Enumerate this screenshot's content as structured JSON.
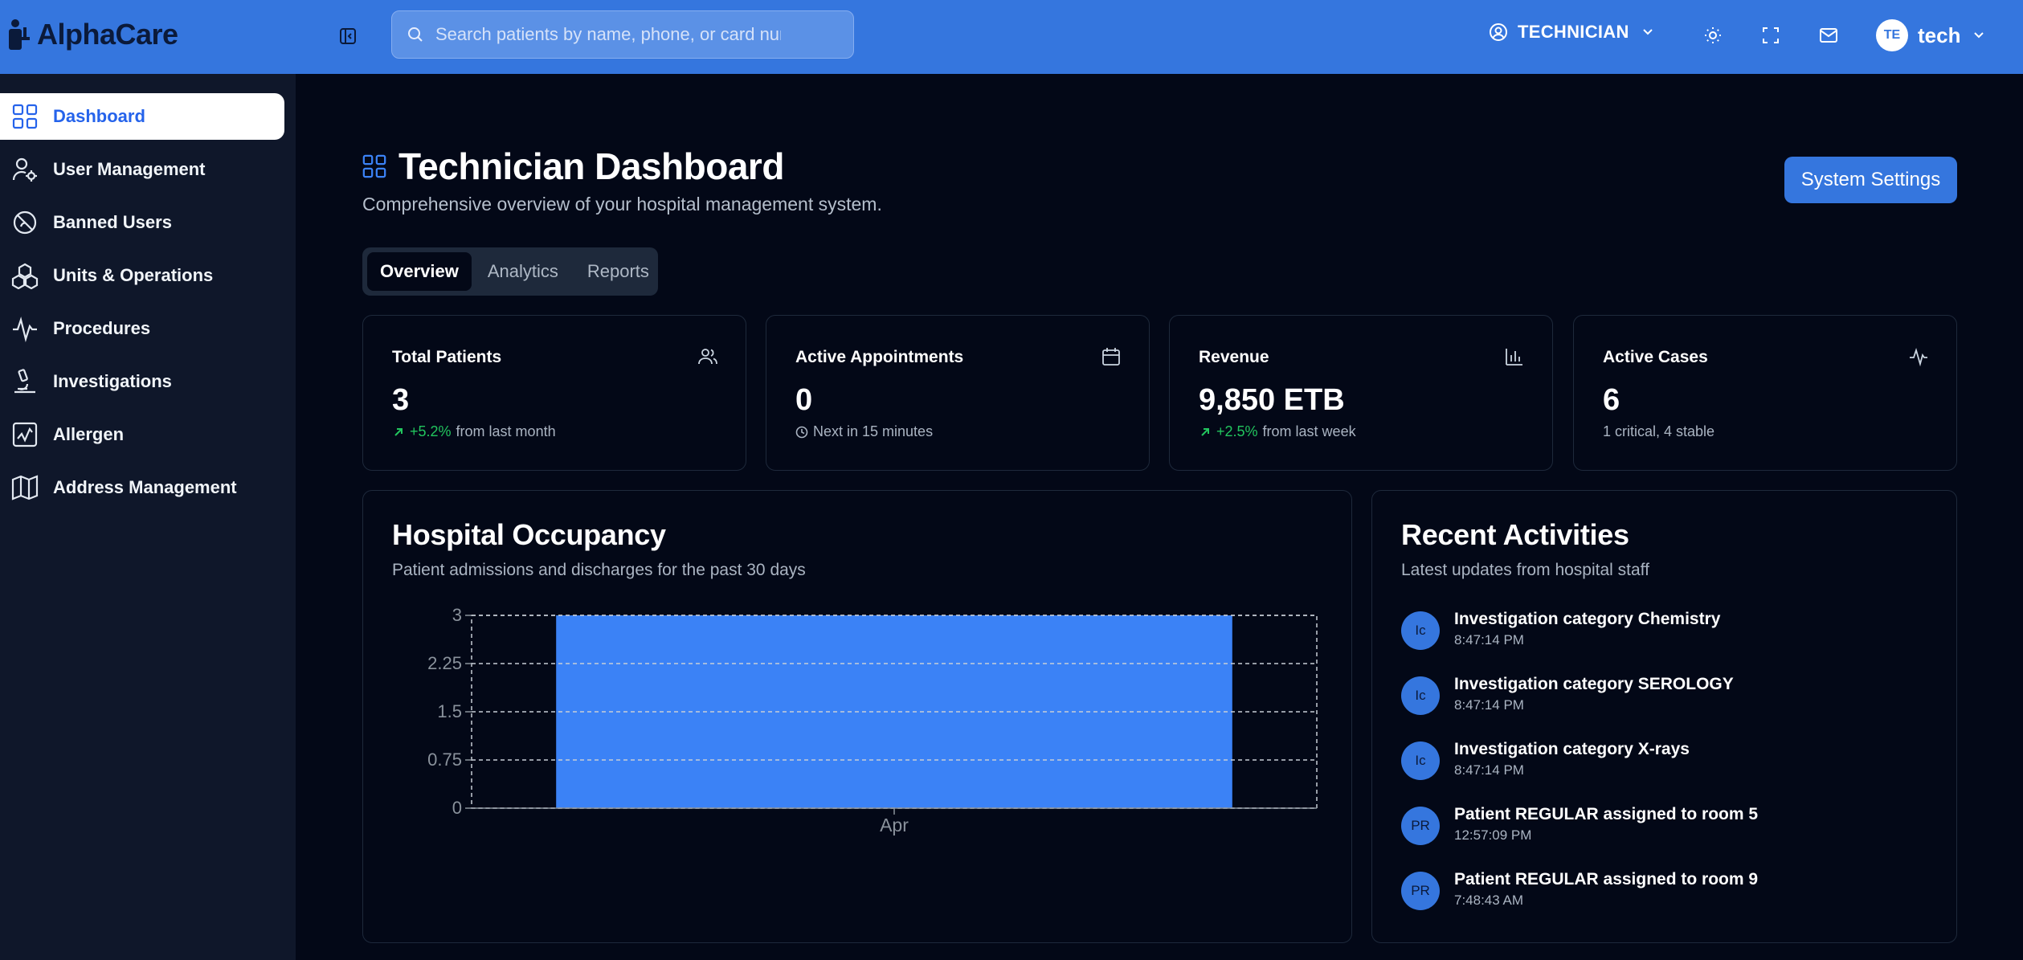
{
  "app": {
    "name": "AlphaCare"
  },
  "search": {
    "placeholder": "Search patients by name, phone, or card number"
  },
  "header": {
    "role": "TECHNICIAN",
    "user_initials": "TE",
    "user_name": "tech",
    "icons": [
      "sun-icon",
      "fullscreen-icon",
      "mail-icon"
    ]
  },
  "sidebar": {
    "items": [
      {
        "label": "Dashboard",
        "icon": "grid-icon",
        "active": true
      },
      {
        "label": "User Management",
        "icon": "user-gear-icon"
      },
      {
        "label": "Banned Users",
        "icon": "ban-icon"
      },
      {
        "label": "Units & Operations",
        "icon": "cubes-icon"
      },
      {
        "label": "Procedures",
        "icon": "activity-icon"
      },
      {
        "label": "Investigations",
        "icon": "microscope-icon"
      },
      {
        "label": "Allergen",
        "icon": "chart-box-icon"
      },
      {
        "label": "Address Management",
        "icon": "map-icon"
      }
    ]
  },
  "page": {
    "title": "Technician Dashboard",
    "subtitle": "Comprehensive overview of your hospital management system.",
    "settings_button": "System Settings",
    "tabs": [
      "Overview",
      "Analytics",
      "Reports"
    ],
    "active_tab": "Overview"
  },
  "stats": [
    {
      "title": "Total Patients",
      "value": "3",
      "trend": "+5.2%",
      "note": "from last month",
      "icon": "users-icon"
    },
    {
      "title": "Active Appointments",
      "value": "0",
      "note": "Next in 15 minutes",
      "icon": "calendar-icon"
    },
    {
      "title": "Revenue",
      "value": "9,850 ETB",
      "trend": "+2.5%",
      "note": "from last week",
      "icon": "bar-chart-icon"
    },
    {
      "title": "Active Cases",
      "value": "6",
      "note": "1 critical, 4 stable",
      "icon": "pulse-icon"
    }
  ],
  "occupancy": {
    "title": "Hospital Occupancy",
    "subtitle": "Patient admissions and discharges for the past 30 days"
  },
  "chart_data": {
    "type": "bar",
    "title": "Hospital Occupancy",
    "categories": [
      "Apr"
    ],
    "values": [
      3
    ],
    "ylim": [
      0,
      3
    ],
    "yticks": [
      "0",
      "0.75",
      "1.5",
      "2.25",
      "3"
    ],
    "grid": true,
    "bar_color": "#3b82f6"
  },
  "activities": {
    "title": "Recent Activities",
    "subtitle": "Latest updates from hospital staff",
    "items": [
      {
        "initials": "Ic",
        "title": "Investigation category Chemistry",
        "time": "8:47:14 PM"
      },
      {
        "initials": "Ic",
        "title": "Investigation category SEROLOGY",
        "time": "8:47:14 PM"
      },
      {
        "initials": "Ic",
        "title": "Investigation category X-rays",
        "time": "8:47:14 PM"
      },
      {
        "initials": "PR",
        "title": "Patient REGULAR assigned to room 5",
        "time": "12:57:09 PM"
      },
      {
        "initials": "PR",
        "title": "Patient REGULAR assigned to room 9",
        "time": "7:48:43 AM"
      }
    ]
  },
  "colors": {
    "accent": "#3576de",
    "background": "#030817",
    "sidebar": "#0f172a",
    "trend_up": "#22c55e"
  }
}
